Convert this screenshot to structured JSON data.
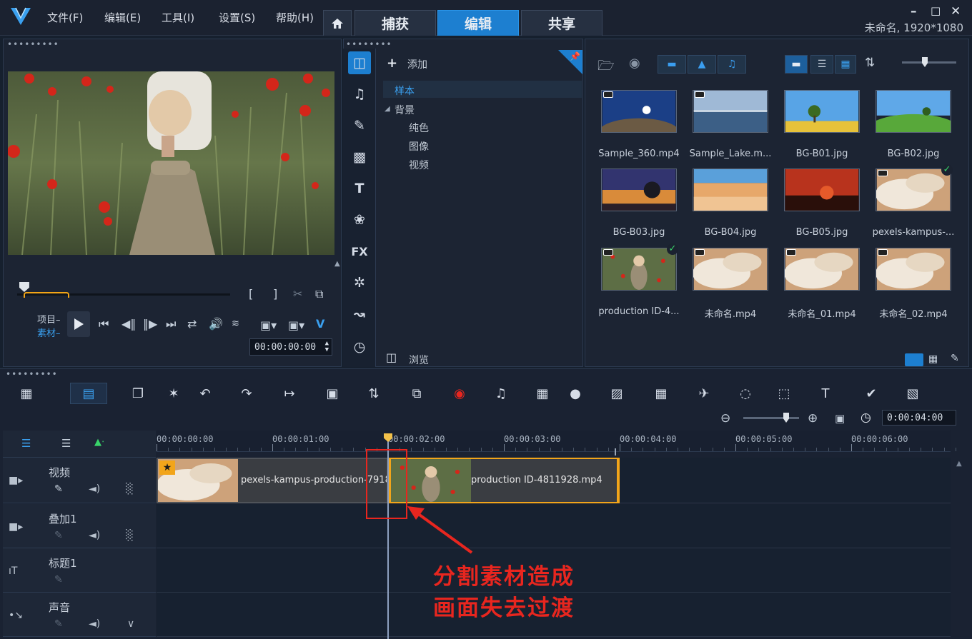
{
  "menubar": {
    "items": [
      "文件(F)",
      "编辑(E)",
      "工具(I)",
      "设置(S)",
      "帮助(H)"
    ],
    "tabs": [
      "捕获",
      "编辑",
      "共享"
    ],
    "active_tab": "编辑",
    "window_controls": [
      "minimize-icon",
      "maximize-icon",
      "close-icon"
    ],
    "project_status": "未命名, 1920*1080"
  },
  "preview": {
    "mode_labels": [
      "项目",
      "素材"
    ],
    "timecode": "00:00:00:00",
    "mark_in": "[",
    "mark_out": "]",
    "controls": [
      "play-icon",
      "to-start-icon",
      "prev-frame-icon",
      "next-frame-icon",
      "to-end-icon",
      "repeat-icon",
      "volume-icon"
    ],
    "scrub_position": 0.03
  },
  "library": {
    "add_label": "添加",
    "tree": {
      "sample": "样本",
      "background": "背景",
      "children": [
        "纯色",
        "图像",
        "视频"
      ]
    },
    "browse_label": "浏览",
    "side_icons": [
      "media-icon",
      "music-note-icon",
      "instant-project-icon",
      "transition-icon",
      "title-icon",
      "graphic-icon",
      "fx-icon",
      "filter-icon",
      "path-icon",
      "speed-icon"
    ],
    "fx_label": "FX",
    "title_glyph": "T",
    "items": [
      {
        "label": "Sample_360.mp4",
        "kind": "video",
        "theme": "night-sky"
      },
      {
        "label": "Sample_Lake.m...",
        "kind": "video",
        "theme": "lake"
      },
      {
        "label": "BG-B01.jpg",
        "kind": "image",
        "theme": "yellow-field"
      },
      {
        "label": "BG-B02.jpg",
        "kind": "image",
        "theme": "green-hill"
      },
      {
        "label": "BG-B03.jpg",
        "kind": "image",
        "theme": "sunset-tree"
      },
      {
        "label": "BG-B04.jpg",
        "kind": "image",
        "theme": "desert"
      },
      {
        "label": "BG-B05.jpg",
        "kind": "image",
        "theme": "red-sunset"
      },
      {
        "label": "pexels-kampus-...",
        "kind": "video",
        "theme": "fabric",
        "checked": true
      },
      {
        "label": "production ID-4...",
        "kind": "video",
        "theme": "flower-field",
        "checked": true
      },
      {
        "label": "未命名.mp4",
        "kind": "video",
        "theme": "fabric"
      },
      {
        "label": "未命名_01.mp4",
        "kind": "video",
        "theme": "fabric"
      },
      {
        "label": "未命名_02.mp4",
        "kind": "video",
        "theme": "fabric"
      }
    ]
  },
  "timeline": {
    "toolbar": [
      "storyboard-view-icon",
      "timeline-view-icon",
      "copy-attributes-icon",
      "magic-tool-icon",
      "undo-icon",
      "redo-icon",
      "fit-icon",
      "crop-icon",
      "split-icon",
      "motion-track-icon",
      "record-icon",
      "audio-icon",
      "multicam-icon",
      "mask-icon",
      "title-icon",
      "split-screen-icon",
      "speed-icon",
      "path-icon",
      "focus-icon",
      "3d-title-icon",
      "sticker-icon",
      "subtitle-icon"
    ],
    "zoom_timecode": "0:00:04:00",
    "ruler_labels": [
      "00:00:00:00",
      "00:00:01:00",
      "00:00:02:00",
      "00:00:03:00",
      "00:00:04:00",
      "00:00:05:00",
      "00:00:06:00"
    ],
    "tracks": [
      {
        "name": "视频",
        "icon": "video-track-icon"
      },
      {
        "name": "叠加1",
        "icon": "overlay-track-icon"
      },
      {
        "name": "标题1",
        "icon": "title-track-icon"
      },
      {
        "name": "声音",
        "icon": "voice-track-icon"
      }
    ],
    "clips": [
      {
        "label": "pexels-kampus-production-7918",
        "start": 0.0,
        "end": 2.0,
        "theme": "fabric"
      },
      {
        "label": "production ID-4811928.mp4",
        "start": 2.0,
        "end": 4.0,
        "theme": "flower-field"
      }
    ],
    "playhead_time": 2.0
  },
  "annotation": {
    "line1": "分割素材造成",
    "line2": "画面失去过渡",
    "color": "#e8261f"
  },
  "colors": {
    "accent": "#1d7fd0",
    "clip_border_selected": "#f2a51a"
  }
}
